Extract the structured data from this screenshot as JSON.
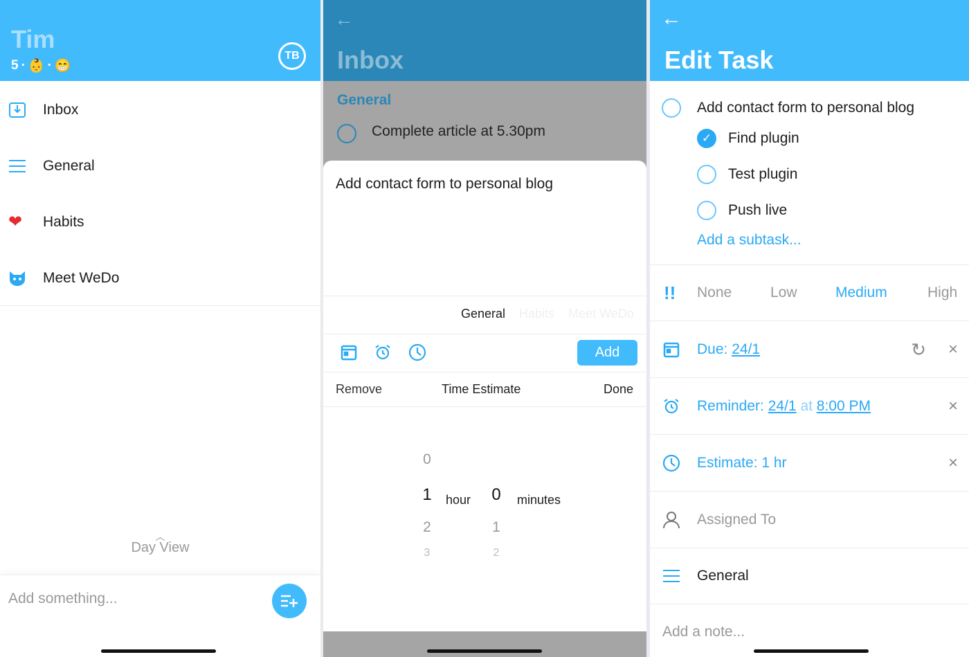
{
  "left": {
    "user_name": "Tim",
    "level": "5",
    "separator": "·",
    "avatar": "TB",
    "emoji1": "👶",
    "emoji2": "😁",
    "nav": [
      {
        "label": "Inbox",
        "icon": "inbox-icon"
      },
      {
        "label": "General",
        "icon": "list-icon"
      },
      {
        "label": "Habits",
        "icon": "heart-icon"
      },
      {
        "label": "Meet WeDo",
        "icon": "cat-icon"
      }
    ],
    "day_view": "Day View",
    "input_placeholder": "Add something..."
  },
  "middle": {
    "title": "Inbox",
    "section": "General",
    "task": "Complete article at 5.30pm",
    "new_task": "Add contact form to personal blog",
    "lists": [
      "General",
      "Habits",
      "Meet WeDo"
    ],
    "add_label": "Add",
    "picker_bar": {
      "remove": "Remove",
      "title": "Time Estimate",
      "done": "Done"
    },
    "hours": [
      "0",
      "1",
      "2",
      "3"
    ],
    "minutes": [
      "0",
      "1",
      "2"
    ],
    "hour_label": "hour",
    "minutes_label": "minutes",
    "selected_hours": "1",
    "selected_minutes": "0"
  },
  "right": {
    "title": "Edit Task",
    "task": "Add contact form to personal blog",
    "subtasks": [
      {
        "label": "Find plugin",
        "done": true
      },
      {
        "label": "Test plugin",
        "done": false
      },
      {
        "label": "Push live",
        "done": false
      }
    ],
    "add_subtask": "Add a subtask...",
    "priorities": [
      "None",
      "Low",
      "Medium",
      "High"
    ],
    "selected_priority": "Medium",
    "due_label": "Due:",
    "due_value": "24/1",
    "reminder_label": "Reminder:",
    "reminder_date": "24/1",
    "reminder_at": "at",
    "reminder_time": "8:00 PM",
    "estimate": "Estimate: 1 hr",
    "assigned": "Assigned To",
    "list": "General",
    "note_placeholder": "Add a note..."
  },
  "colors": {
    "accent": "#42bbfd",
    "link": "#2aa9f5"
  }
}
